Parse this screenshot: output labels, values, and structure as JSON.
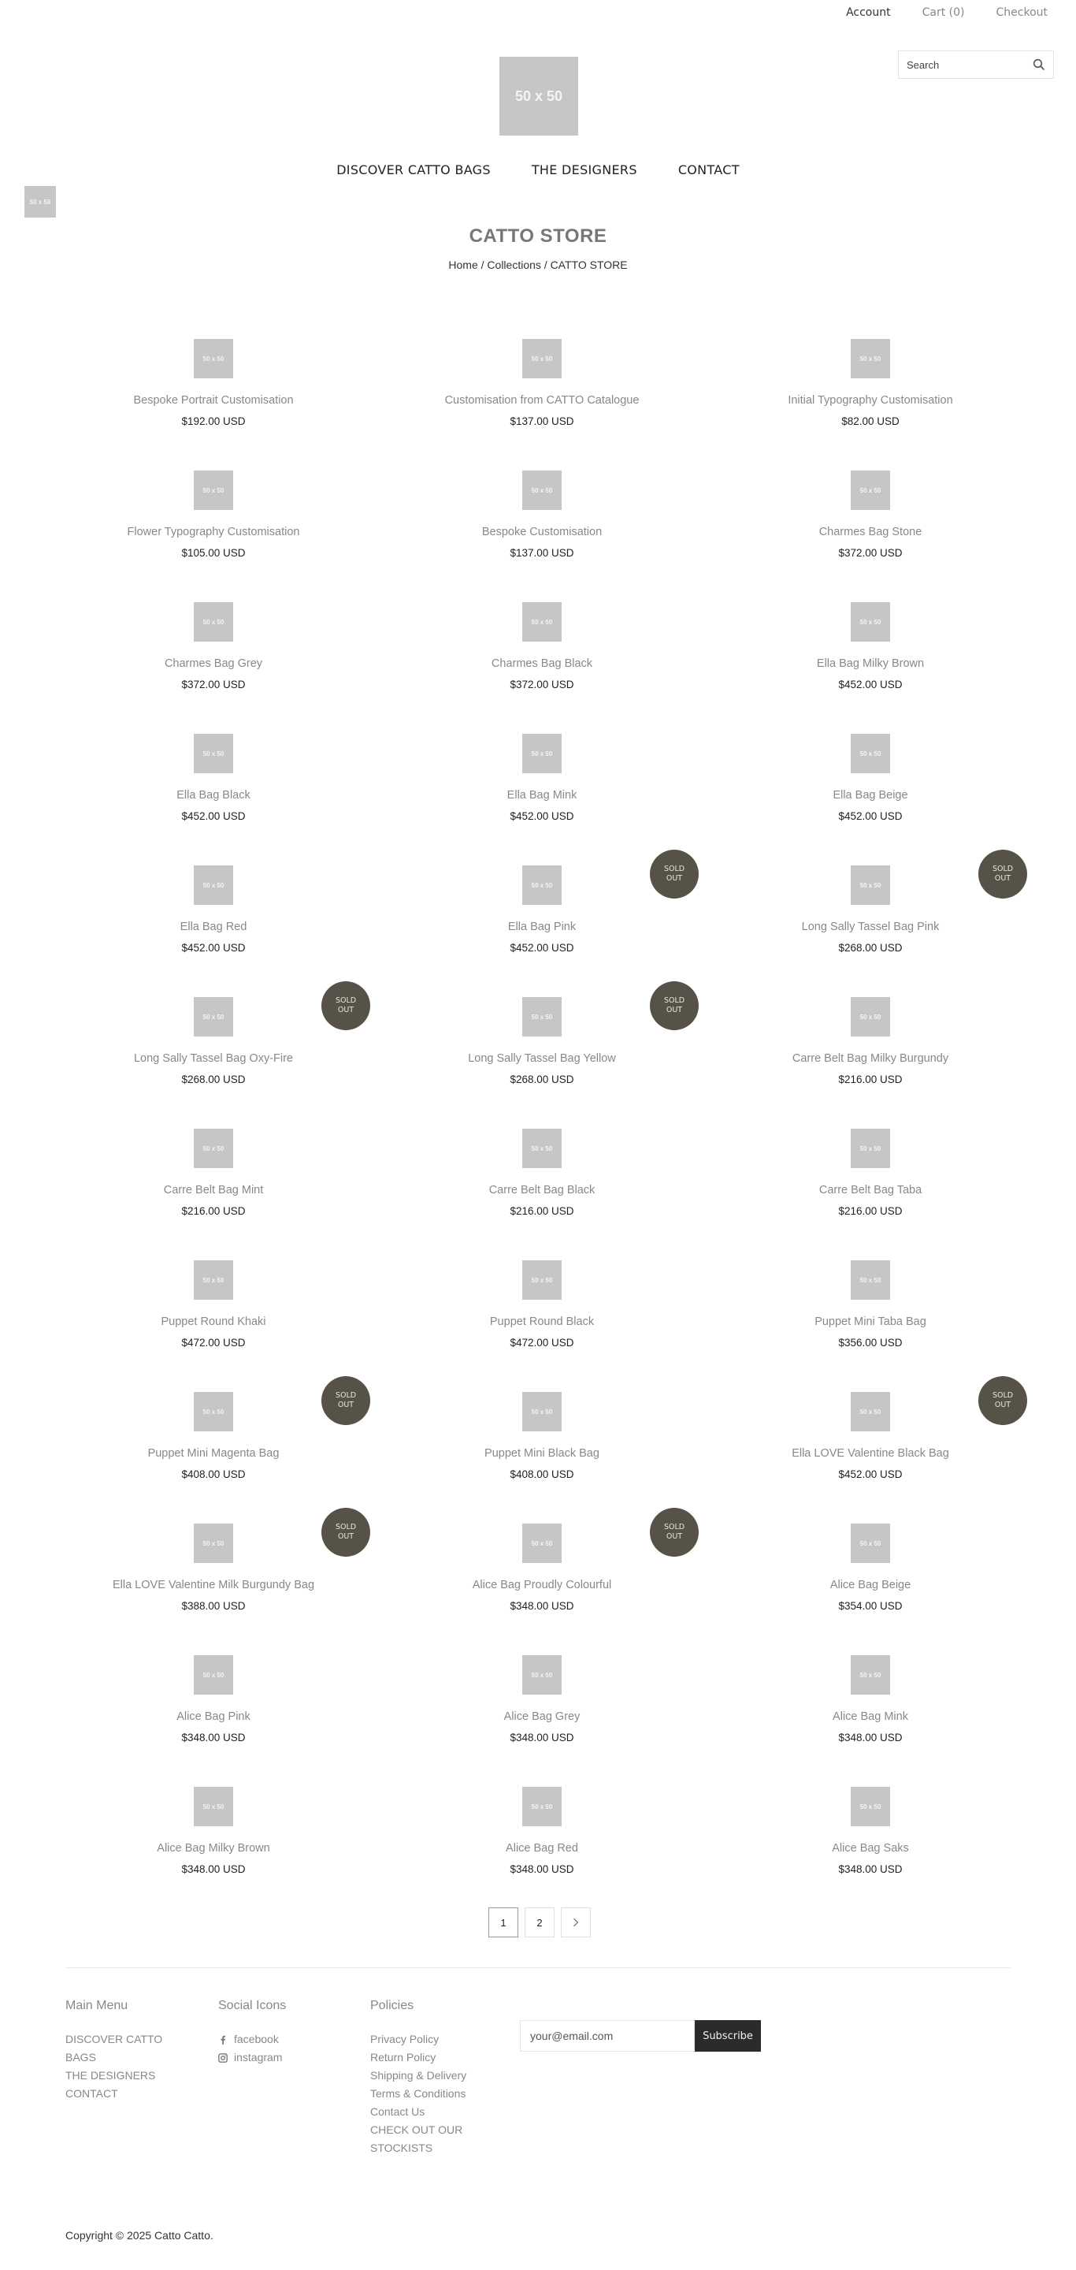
{
  "header": {
    "account": "Account",
    "cart": "Cart (0)",
    "checkout": "Checkout",
    "logo_text": "50 x 50",
    "side_image_text": "50 x 50",
    "search_placeholder": "Search"
  },
  "nav": {
    "items": [
      "DISCOVER CATTO BAGS",
      "THE DESIGNERS",
      "CONTACT"
    ]
  },
  "collection": {
    "title": "CATTO STORE",
    "breadcrumb": "Home / Collections / CATTO STORE"
  },
  "products": [
    {
      "name": "Bespoke Portrait Customisation",
      "price": "$192.00 USD",
      "thumb": "50 x 50",
      "badge": ""
    },
    {
      "name": "Customisation from CATTO Catalogue",
      "price": "$137.00 USD",
      "thumb": "50 x 50",
      "badge": ""
    },
    {
      "name": "Initial Typography Customisation",
      "price": "$82.00 USD",
      "thumb": "50 x 50",
      "badge": ""
    },
    {
      "name": "Flower Typography Customisation",
      "price": "$105.00 USD",
      "thumb": "50 x 50",
      "badge": ""
    },
    {
      "name": "Bespoke Customisation",
      "price": "$137.00 USD",
      "thumb": "50 x 50",
      "badge": ""
    },
    {
      "name": "Charmes Bag Stone",
      "price": "$372.00 USD",
      "thumb": "50 x 50",
      "badge": ""
    },
    {
      "name": "Charmes Bag Grey",
      "price": "$372.00 USD",
      "thumb": "50 x 50",
      "badge": ""
    },
    {
      "name": "Charmes Bag Black",
      "price": "$372.00 USD",
      "thumb": "50 x 50",
      "badge": ""
    },
    {
      "name": "Ella Bag Milky Brown",
      "price": "$452.00 USD",
      "thumb": "50 x 50",
      "badge": ""
    },
    {
      "name": "Ella Bag Black",
      "price": "$452.00 USD",
      "thumb": "50 x 50",
      "badge": ""
    },
    {
      "name": "Ella Bag Mink",
      "price": "$452.00 USD",
      "thumb": "50 x 50",
      "badge": ""
    },
    {
      "name": "Ella Bag Beige",
      "price": "$452.00 USD",
      "thumb": "50 x 50",
      "badge": ""
    },
    {
      "name": "Ella Bag Red",
      "price": "$452.00 USD",
      "thumb": "50 x 50",
      "badge": ""
    },
    {
      "name": "Ella Bag Pink",
      "price": "$452.00 USD",
      "thumb": "50 x 50",
      "badge": "SOLD OUT"
    },
    {
      "name": "Long Sally Tassel Bag Pink",
      "price": "$268.00 USD",
      "thumb": "50 x 50",
      "badge": "SOLD OUT"
    },
    {
      "name": "Long Sally Tassel Bag Oxy-Fire",
      "price": "$268.00 USD",
      "thumb": "50 x 50",
      "badge": "SOLD OUT"
    },
    {
      "name": "Long Sally Tassel Bag Yellow",
      "price": "$268.00 USD",
      "thumb": "50 x 50",
      "badge": "SOLD OUT"
    },
    {
      "name": "Carre Belt Bag Milky Burgundy",
      "price": "$216.00 USD",
      "thumb": "50 x 50",
      "badge": ""
    },
    {
      "name": "Carre Belt Bag Mint",
      "price": "$216.00 USD",
      "thumb": "50 x 50",
      "badge": ""
    },
    {
      "name": "Carre Belt Bag Black",
      "price": "$216.00 USD",
      "thumb": "50 x 50",
      "badge": ""
    },
    {
      "name": "Carre Belt Bag Taba",
      "price": "$216.00 USD",
      "thumb": "50 x 50",
      "badge": ""
    },
    {
      "name": "Puppet Round Khaki",
      "price": "$472.00 USD",
      "thumb": "50 x 50",
      "badge": ""
    },
    {
      "name": "Puppet Round Black",
      "price": "$472.00 USD",
      "thumb": "50 x 50",
      "badge": ""
    },
    {
      "name": "Puppet Mini Taba Bag",
      "price": "$356.00 USD",
      "thumb": "50 x 50",
      "badge": ""
    },
    {
      "name": "Puppet Mini Magenta Bag",
      "price": "$408.00 USD",
      "thumb": "50 x 50",
      "badge": "SOLD OUT"
    },
    {
      "name": "Puppet Mini Black Bag",
      "price": "$408.00 USD",
      "thumb": "50 x 50",
      "badge": ""
    },
    {
      "name": "Ella LOVE Valentine Black Bag",
      "price": "$452.00 USD",
      "thumb": "50 x 50",
      "badge": "SOLD OUT"
    },
    {
      "name": "Ella LOVE Valentine Milk Burgundy Bag",
      "price": "$388.00 USD",
      "thumb": "50 x 50",
      "badge": "SOLD OUT"
    },
    {
      "name": "Alice Bag Proudly Colourful",
      "price": "$348.00 USD",
      "thumb": "50 x 50",
      "badge": "SOLD OUT"
    },
    {
      "name": "Alice Bag Beige",
      "price": "$354.00 USD",
      "thumb": "50 x 50",
      "badge": ""
    },
    {
      "name": "Alice Bag Pink",
      "price": "$348.00 USD",
      "thumb": "50 x 50",
      "badge": ""
    },
    {
      "name": "Alice Bag Grey",
      "price": "$348.00 USD",
      "thumb": "50 x 50",
      "badge": ""
    },
    {
      "name": "Alice Bag Mink",
      "price": "$348.00 USD",
      "thumb": "50 x 50",
      "badge": ""
    },
    {
      "name": "Alice Bag Milky Brown",
      "price": "$348.00 USD",
      "thumb": "50 x 50",
      "badge": ""
    },
    {
      "name": "Alice Bag Red",
      "price": "$348.00 USD",
      "thumb": "50 x 50",
      "badge": ""
    },
    {
      "name": "Alice Bag Saks",
      "price": "$348.00 USD",
      "thumb": "50 x 50",
      "badge": ""
    }
  ],
  "pagination": {
    "pages": [
      "1",
      "2"
    ],
    "current": "1",
    "next_icon": "chevron-right-icon"
  },
  "footer": {
    "main_menu": {
      "title": "Main Menu",
      "items": [
        "DISCOVER CATTO BAGS",
        "THE DESIGNERS",
        "CONTACT"
      ]
    },
    "social": {
      "title": "Social Icons",
      "items": [
        {
          "label": "facebook",
          "icon": "facebook-icon"
        },
        {
          "label": "instagram",
          "icon": "instagram-icon"
        }
      ]
    },
    "policies": {
      "title": "Policies",
      "items": [
        "Privacy Policy",
        "Return Policy",
        "Shipping & Delivery",
        "Terms & Conditions",
        "Contact Us",
        "CHECK OUT OUR STOCKISTS"
      ]
    },
    "newsletter": {
      "placeholder": "your@email.com",
      "button": "Subscribe"
    },
    "copyright": "Copyright © 2025 Catto Catto."
  },
  "colors": {
    "badge_bg": "#575247",
    "placeholder_bg": "#c6c6c6",
    "subscribe_bg": "#2b2b2b"
  }
}
